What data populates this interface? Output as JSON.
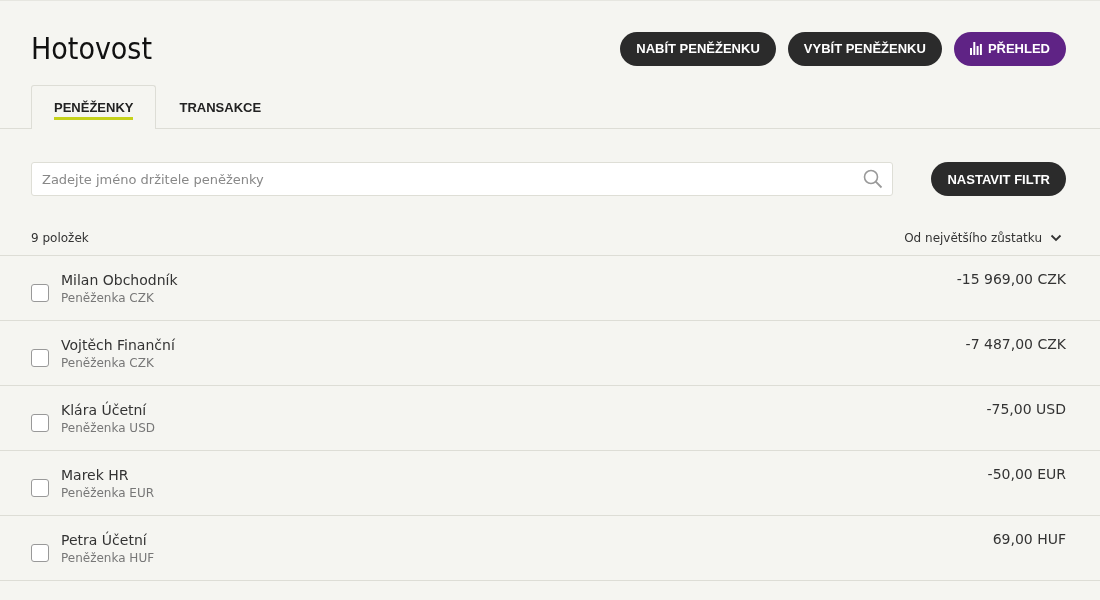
{
  "title": "Hotovost",
  "actions": [
    {
      "label": "NABÍT PENĚŽENKU",
      "kind": "dark"
    },
    {
      "label": "VYBÍT PENĚŽENKU",
      "kind": "dark"
    },
    {
      "label": "PŘEHLED",
      "kind": "primary"
    }
  ],
  "tabs": [
    {
      "label": "PENĚŽENKY",
      "selected": true
    },
    {
      "label": "TRANSAKCE",
      "selected": false
    }
  ],
  "search": {
    "placeholder": "Zadejte jméno držitele peněženky"
  },
  "filter_button": "NASTAVIT FILTR",
  "count": "9 položek",
  "sort": "Od největšího zůstatku",
  "wallets": [
    {
      "name": "Milan Obchodník",
      "wallet": "Peněženka CZK",
      "balance": "-15 969,00 CZK",
      "checked": false
    },
    {
      "name": "Vojtěch Finanční",
      "wallet": "Peněženka CZK",
      "balance": "-7 487,00 CZK",
      "checked": false
    },
    {
      "name": "Klára Účetní",
      "wallet": "Peněženka USD",
      "balance": "-75,00 USD",
      "checked": false
    },
    {
      "name": "Marek HR",
      "wallet": "Peněženka EUR",
      "balance": "-50,00 EUR",
      "checked": false
    },
    {
      "name": "Petra Účetní",
      "wallet": "Peněženka HUF",
      "balance": "69,00 HUF",
      "checked": false
    }
  ]
}
